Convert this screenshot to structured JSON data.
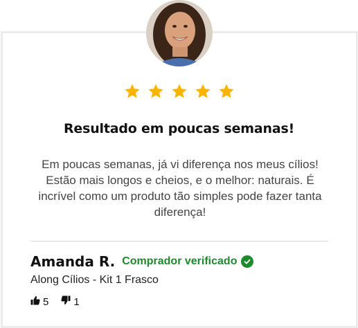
{
  "review": {
    "rating": 5,
    "title": "Resultado em poucas semanas!",
    "body": "Em poucas semanas, já vi diferença nos meus cílios! Estão mais longos e cheios, e o melhor: naturais. É incrível como um produto tão simples pode fazer tanta diferença!",
    "reviewer_name": "Amanda R.",
    "verified_label": "Comprador verificado",
    "product": "Along Cílios - Kit 1 Frasco",
    "helpful_count": "5",
    "unhelpful_count": "1"
  },
  "colors": {
    "star": "#f7b500",
    "verified": "#1e8a2b"
  },
  "icons": {
    "star": "star-icon",
    "verified": "check-circle-icon",
    "thumbs_up": "thumbs-up-icon",
    "thumbs_down": "thumbs-down-icon"
  }
}
